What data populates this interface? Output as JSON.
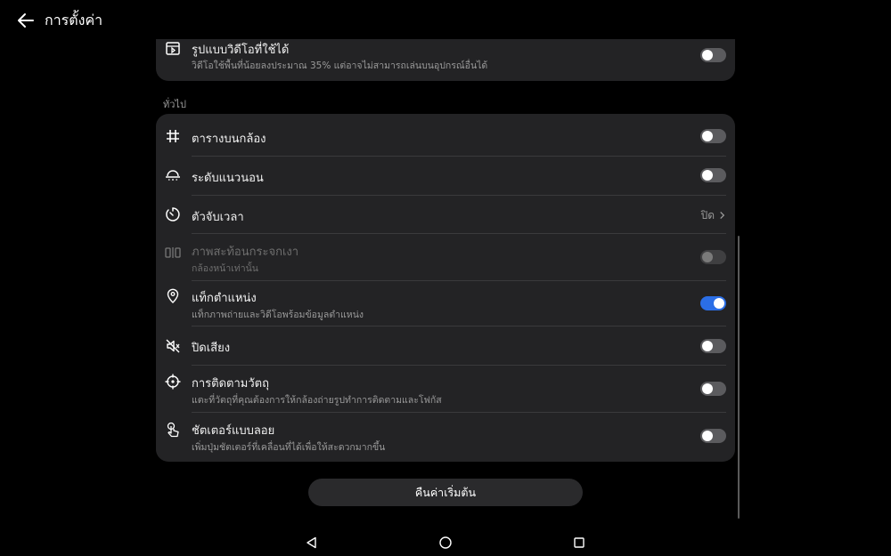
{
  "header": {
    "back_icon": "arrow-left-icon",
    "title": "การตั้งค่า"
  },
  "top_card": {
    "item": {
      "icon": "video-format-icon",
      "label": "รูปแบบวิดีโอที่ใช้ได้",
      "sub": "วิดีโอใช้พื้นที่น้อยลงประมาณ 35% แต่อาจไม่สามารถเล่นบนอุปกรณ์อื่นได้",
      "toggle": false
    }
  },
  "general": {
    "section_label": "ทั่วไป",
    "items": [
      {
        "icon": "grid-icon",
        "label": "ตารางบนกล้อง",
        "toggle": false
      },
      {
        "icon": "level-icon",
        "label": "ระดับแนวนอน",
        "toggle": false
      },
      {
        "icon": "timer-icon",
        "label": "ตัวจับเวลา",
        "value": "ปิด"
      },
      {
        "icon": "mirror-icon",
        "label": "ภาพสะท้อนกระจกเงา",
        "sub": "กล้องหน้าเท่านั้น",
        "toggle": false,
        "disabled": true
      },
      {
        "icon": "location-icon",
        "label": "แท็กตำแหน่ง",
        "sub": "แท็กภาพถ่ายและวิดีโอพร้อมข้อมูลตำแหน่ง",
        "toggle": true
      },
      {
        "icon": "mute-icon",
        "label": "ปิดเสียง",
        "toggle": false
      },
      {
        "icon": "tracking-icon",
        "label": "การติดตามวัตถุ",
        "sub": "แตะที่วัตถุที่คุณต้องการให้กล้องถ่ายรูปทำการติดตามและโฟกัส",
        "toggle": false
      },
      {
        "icon": "floating-shutter-icon",
        "label": "ชัตเตอร์แบบลอย",
        "sub": "เพิ่มปุ่มชัตเตอร์ที่เคลื่อนที่ได้เพื่อให้สะดวกมากขึ้น",
        "toggle": false
      }
    ]
  },
  "reset_button": "คืนค่าเริ่มต้น",
  "navbar": {
    "back": "nav-back-icon",
    "home": "nav-home-icon",
    "recents": "nav-recents-icon"
  },
  "colors": {
    "background": "#000000",
    "card": "#232325",
    "toggle_on": "#2b6ee6",
    "toggle_off": "#5b5b5e"
  }
}
